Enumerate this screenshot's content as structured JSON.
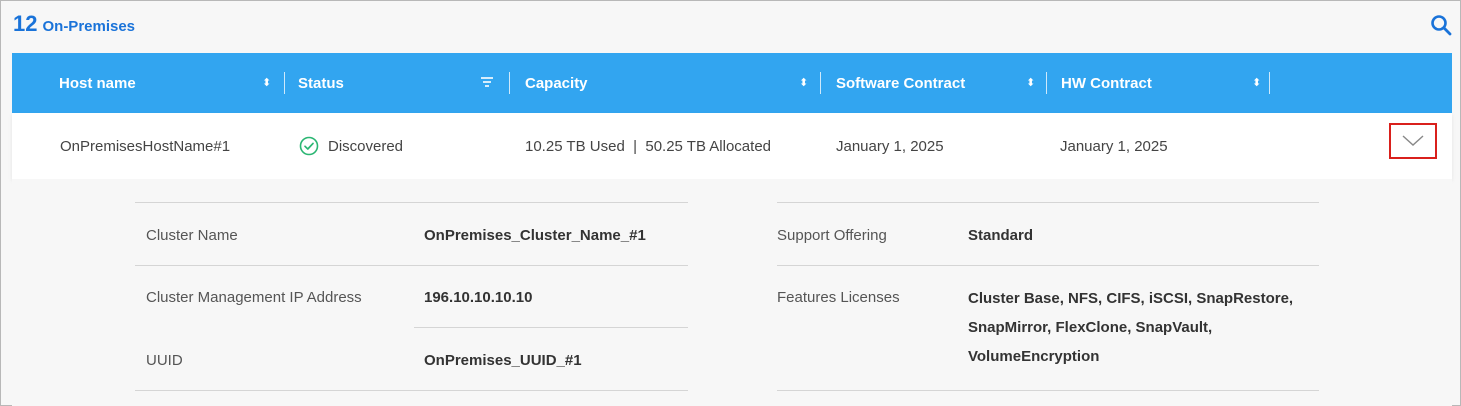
{
  "title": {
    "count": "12",
    "label": "On-Premises"
  },
  "table": {
    "columns": [
      {
        "label": "Host name",
        "control": "sort"
      },
      {
        "label": "Status",
        "control": "filter"
      },
      {
        "label": "Capacity",
        "control": "sort"
      },
      {
        "label": "Software Contract",
        "control": "sort"
      },
      {
        "label": "HW Contract",
        "control": "sort"
      }
    ],
    "row": {
      "host_name": "OnPremisesHostName#1",
      "status": "Discovered",
      "capacity": "10.25 TB Used  |  50.25 TB Allocated",
      "software_contract": "January 1, 2025",
      "hw_contract": "January 1, 2025"
    }
  },
  "details": {
    "left": [
      {
        "label": "Cluster Name",
        "value": "OnPremises_Cluster_Name_#1"
      },
      {
        "label": "Cluster Management IP Address",
        "value": "196.10.10.10.10"
      },
      {
        "label": "UUID",
        "value": "OnPremises_UUID_#1"
      }
    ],
    "right": [
      {
        "label": "Support Offering",
        "value": "Standard"
      },
      {
        "label": "Features Licenses",
        "value": "Cluster Base, NFS, CIFS, iSCSI, SnapRestore, SnapMirror, FlexClone, SnapVault, VolumeEncryption"
      }
    ]
  },
  "colors": {
    "accent": "#1a73d9",
    "header_bg": "#32a5f0",
    "status_ok": "#2bb673",
    "highlight_border": "#d9201c"
  },
  "icons": {
    "search": "search-icon",
    "sort": "sort-icon",
    "filter": "filter-icon",
    "status": "check-circle-icon",
    "expand": "chevron-down-icon"
  }
}
